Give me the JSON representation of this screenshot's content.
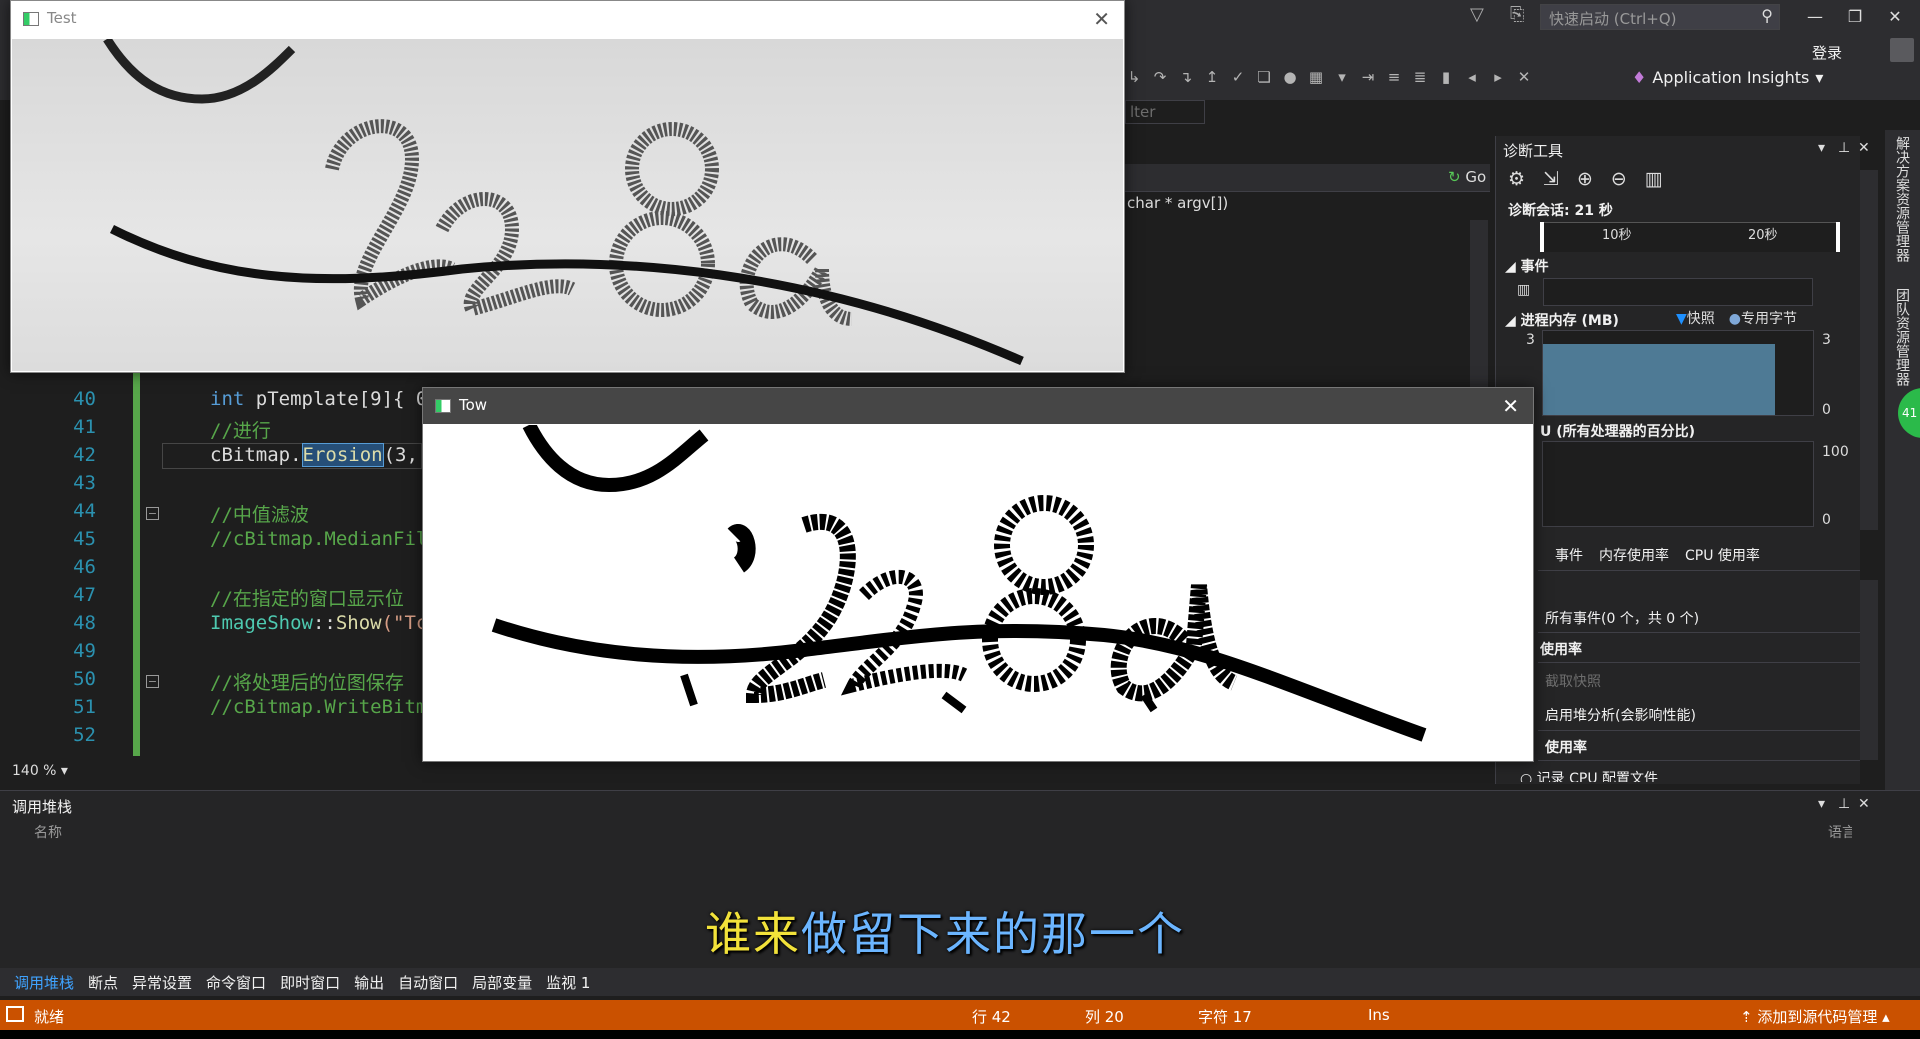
{
  "header": {
    "quick_launch_placeholder": "快速启动 (Ctrl+Q)",
    "login": "登录",
    "application_insights": "Application Insights",
    "filter_placeholder": "lter",
    "go_label": "Go",
    "signature": "char * argv[])"
  },
  "editor": {
    "zoom": "140 %",
    "lines": [
      {
        "num": "40",
        "text": "int pTemplate[9]{ 0"
      },
      {
        "num": "41",
        "text": "//进行"
      },
      {
        "num": "42",
        "text": "cBitmap.Erosion(3,"
      },
      {
        "num": "43",
        "text": ""
      },
      {
        "num": "44",
        "text": "//中值滤波"
      },
      {
        "num": "45",
        "text": "//cBitmap.MedianFil"
      },
      {
        "num": "46",
        "text": ""
      },
      {
        "num": "47",
        "text": "//在指定的窗口显示位"
      },
      {
        "num": "48",
        "text": "ImageShow::Show(\"Tc"
      },
      {
        "num": "49",
        "text": ""
      },
      {
        "num": "50",
        "text": "//将处理后的位图保存"
      },
      {
        "num": "51",
        "text": "//cBitmap.WriteBitm"
      },
      {
        "num": "52",
        "text": ""
      }
    ],
    "line42_parts": {
      "obj": "cBitmap.",
      "method": "Erosion",
      "rest": "(3,"
    },
    "line48_parts": {
      "type": "ImageShow",
      "sep": "::",
      "fn": "Show",
      "str": "(\"Tc"
    },
    "line40_parts": {
      "kw": "int",
      "rest": " pTemplate[9]{ 0"
    }
  },
  "diagnostics": {
    "title": "诊断工具",
    "session": "诊断会话: 21 秒",
    "ticks": [
      "10秒",
      "20秒"
    ],
    "events_header": "事件",
    "memory_header": "进程内存 (MB)",
    "legend": {
      "snapshot": "快照",
      "private_bytes": "专用字节"
    },
    "memory_axis": {
      "max": "3",
      "min": "0"
    },
    "memory_fill_fraction": 0.85,
    "cpu_header": "U (所有处理器的百分比)",
    "cpu_axis": {
      "max": "100",
      "min": "0"
    },
    "tabs": [
      "事件",
      "内存使用率",
      "CPU 使用率"
    ],
    "list": {
      "all_events": "所有事件(0 个，共 0 个)",
      "usage1": "使用率",
      "snapshot": "截取快照",
      "heap_analysis": "启用堆分析(会影响性能)",
      "usage2": "使用率",
      "cpu_profile": "记录 CPU 配置文件"
    }
  },
  "side_tabs": [
    "解决方案资源管理器",
    "团队资源管理器"
  ],
  "side_badge": "41",
  "callstack": {
    "title": "调用堆栈",
    "col_name": "名称",
    "col_lang": "语言"
  },
  "subtitle": {
    "part1": "谁来",
    "part2": "做留下来的那一个"
  },
  "bottom_tabs": [
    "调用堆栈",
    "断点",
    "异常设置",
    "命令窗口",
    "即时窗口",
    "输出",
    "自动窗口",
    "局部变量",
    "监视 1"
  ],
  "status": {
    "ready": "就绪",
    "row": "行 42",
    "col": "列 20",
    "char": "字符 17",
    "ins": "Ins",
    "add_source": "添加到源代码管理"
  },
  "windows": {
    "test_title": "Test",
    "tow_title": "Tow"
  },
  "colors": {
    "status_bar": "#ca5100",
    "memory_fill": "#4e7a95",
    "change_bar": "#57a64a",
    "accent": "#3fa3ff"
  }
}
